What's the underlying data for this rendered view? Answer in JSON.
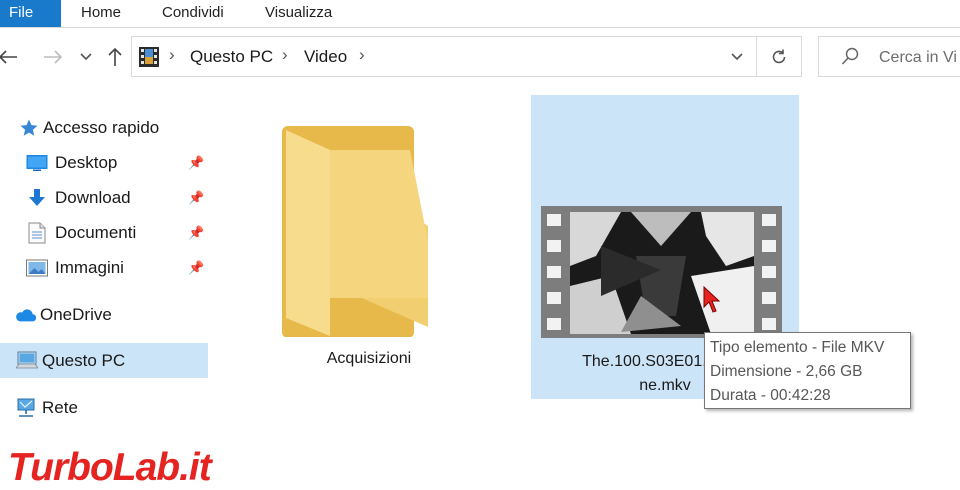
{
  "ribbon": {
    "tabs": [
      {
        "label": "File"
      },
      {
        "label": "Home"
      },
      {
        "label": "Condividi"
      },
      {
        "label": "Visualizza"
      }
    ]
  },
  "nav": {
    "back_icon": "arrow-left-icon",
    "forward_icon": "arrow-right-icon",
    "recent_icon": "chevron-down-icon",
    "up_icon": "arrow-up-icon"
  },
  "address": {
    "crumbs": [
      "Questo PC",
      "Video"
    ],
    "icon": "video-library-icon"
  },
  "search": {
    "placeholder": "Cerca in Video",
    "visible_text": "Cerca in Vi"
  },
  "sidebar": {
    "items": [
      {
        "label": "Accesso rapido",
        "icon": "star-icon"
      },
      {
        "label": "Desktop",
        "icon": "desktop-icon",
        "pinned": true
      },
      {
        "label": "Download",
        "icon": "download-arrow-icon",
        "pinned": true
      },
      {
        "label": "Documenti",
        "icon": "document-icon",
        "pinned": true
      },
      {
        "label": "Immagini",
        "icon": "pictures-icon",
        "pinned": true
      },
      {
        "label": "OneDrive",
        "icon": "cloud-icon"
      },
      {
        "label": "Questo PC",
        "icon": "computer-icon",
        "selected": true
      },
      {
        "label": "Rete",
        "icon": "network-icon"
      }
    ]
  },
  "content": {
    "folder": {
      "name": "Acquisizioni",
      "icon": "folder-icon"
    },
    "file": {
      "name_line1": "The.100.S03E01.Wanh",
      "name_line2": "ne.mkv",
      "icon": "video-thumbnail-icon",
      "selected": true
    },
    "tooltip": {
      "line1": "Tipo elemento - File MKV",
      "line2": "Dimensione - 2,66 GB",
      "line3": "Durata - 00:42:28"
    }
  },
  "colors": {
    "accent": "#1979ca",
    "selection": "#cce4f7",
    "folder": "#f5d57d",
    "watermark_red": "#e52421"
  },
  "watermark": {
    "text": "TurboLab.it"
  }
}
